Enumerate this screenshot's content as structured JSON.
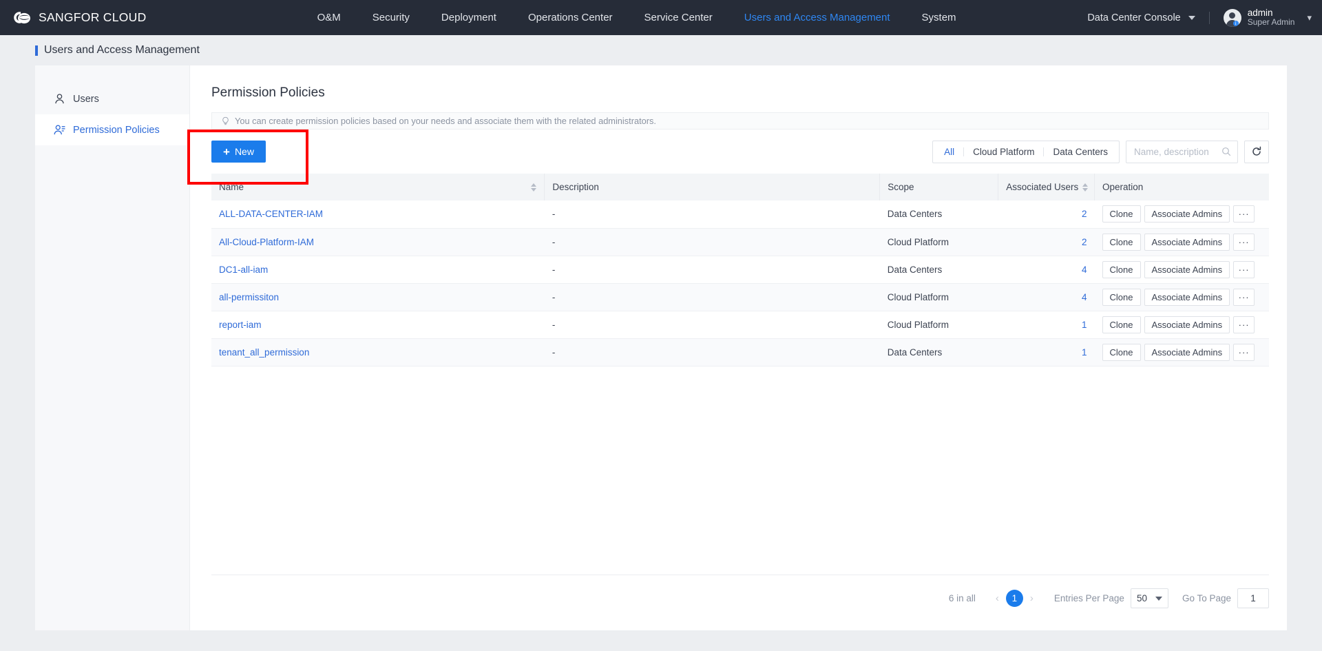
{
  "brand": {
    "name": "SANGFOR CLOUD",
    "logo_icon": "cloud-logo-icon"
  },
  "topnav": {
    "items": [
      {
        "label": "O&M",
        "active": false
      },
      {
        "label": "Security",
        "active": false
      },
      {
        "label": "Deployment",
        "active": false
      },
      {
        "label": "Operations Center",
        "active": false
      },
      {
        "label": "Service Center",
        "active": false
      },
      {
        "label": "Users and Access Management",
        "active": true
      },
      {
        "label": "System",
        "active": false
      }
    ],
    "console_selector": "Data Center Console",
    "user": {
      "name": "admin",
      "role": "Super Admin"
    }
  },
  "page": {
    "title": "Users and Access Management"
  },
  "sidebar": {
    "items": [
      {
        "label": "Users",
        "icon": "user-icon",
        "active": false
      },
      {
        "label": "Permission Policies",
        "icon": "user-list-icon",
        "active": true
      }
    ]
  },
  "main": {
    "title": "Permission Policies",
    "tip": "You can create permission policies based on your needs and associate them with the related administrators.",
    "new_button": "New",
    "filters": [
      {
        "label": "All",
        "active": true
      },
      {
        "label": "Cloud Platform",
        "active": false
      },
      {
        "label": "Data Centers",
        "active": false
      }
    ],
    "search": {
      "placeholder": "Name, description",
      "value": ""
    },
    "refresh_title": "Refresh"
  },
  "table": {
    "columns": [
      {
        "label": "Name",
        "sortable": true
      },
      {
        "label": "Description",
        "sortable": false
      },
      {
        "label": "Scope",
        "sortable": false
      },
      {
        "label": "Associated Users",
        "sortable": true
      },
      {
        "label": "Operation",
        "sortable": false
      }
    ],
    "op_labels": {
      "clone": "Clone",
      "associate": "Associate Admins",
      "more": "···"
    },
    "rows": [
      {
        "name": "ALL-DATA-CENTER-IAM",
        "description": "-",
        "scope": "Data Centers",
        "users": "2"
      },
      {
        "name": "All-Cloud-Platform-IAM",
        "description": "-",
        "scope": "Cloud Platform",
        "users": "2"
      },
      {
        "name": "DC1-all-iam",
        "description": "-",
        "scope": "Data Centers",
        "users": "4"
      },
      {
        "name": "all-permissiton",
        "description": "-",
        "scope": "Cloud Platform",
        "users": "4"
      },
      {
        "name": "report-iam",
        "description": "-",
        "scope": "Cloud Platform",
        "users": "1"
      },
      {
        "name": "tenant_all_permission",
        "description": "-",
        "scope": "Data Centers",
        "users": "1"
      }
    ]
  },
  "pagination": {
    "total": "6 in all",
    "prev": "‹",
    "next": "›",
    "current_page": "1",
    "entries_label": "Entries Per Page",
    "entries_value": "50",
    "goto_label": "Go To Page",
    "goto_value": "1"
  },
  "colors": {
    "nav_bg": "#262c38",
    "accent": "#1b7ceb",
    "link": "#2f6bd8",
    "annotation": "#fe0000",
    "page_bg": "#eceef1"
  }
}
